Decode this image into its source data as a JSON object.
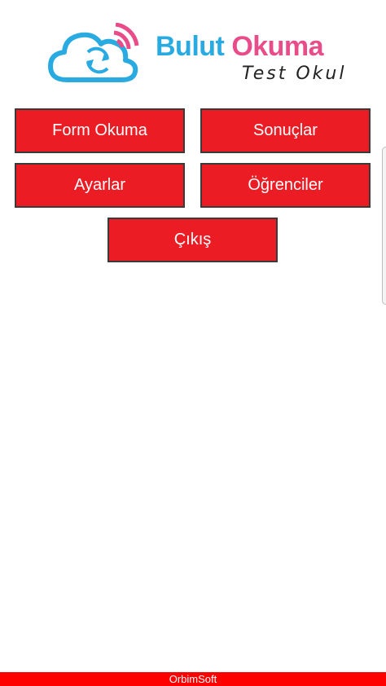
{
  "logo": {
    "title_part1": "Bulut",
    "title_part2": "Okuma",
    "subtitle": "Test Okul",
    "colors": {
      "blue": "#29abe2",
      "pink": "#e84d8a"
    }
  },
  "menu": {
    "form_okuma": "Form Okuma",
    "sonuclar": "Sonuçlar",
    "ayarlar": "Ayarlar",
    "ogrenciler": "Öğrenciler",
    "cikis": "Çıkış"
  },
  "footer": {
    "text": "OrbimSoft"
  },
  "colors": {
    "button_bg": "#ec1c24",
    "footer_bg": "#ff0000"
  }
}
